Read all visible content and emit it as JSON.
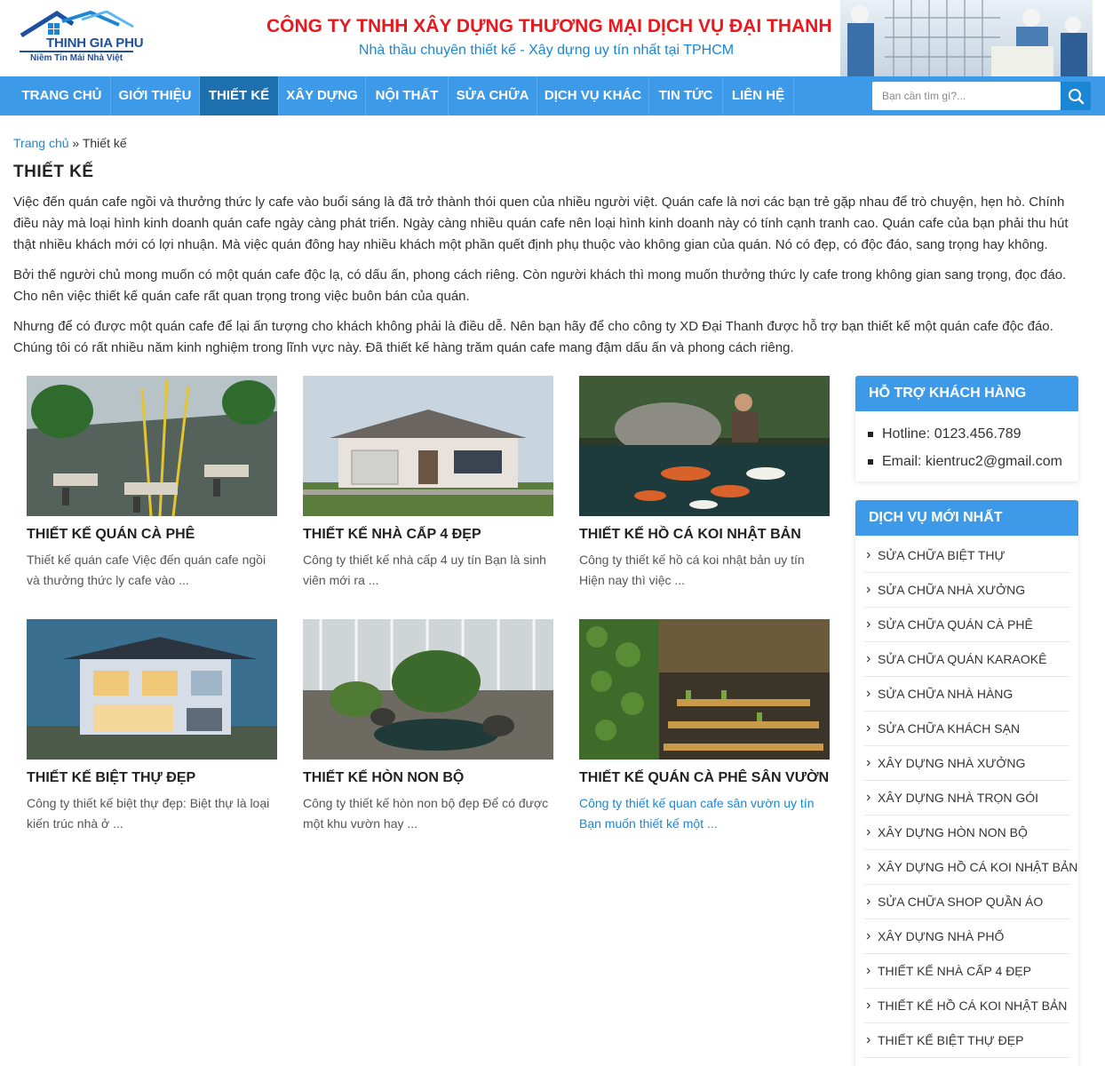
{
  "header": {
    "logo_name": "THINH GIA PHU",
    "logo_tagline": "Niềm Tin Mái Nhà Việt",
    "company_name": "CÔNG TY TNHH XÂY DỰNG THƯƠNG MẠI DỊCH VỤ ĐẠI THANH",
    "slogan": "Nhà thầu chuyên thiết kế - Xây dựng uy tín nhất tại TPHCM"
  },
  "nav": {
    "items": [
      "TRANG CHỦ",
      "GIỚI THIỆU",
      "THIẾT KẾ",
      "XÂY DỰNG",
      "NỘI THẤT",
      "SỬA CHỮA",
      "DỊCH VỤ KHÁC",
      "TIN TỨC",
      "LIÊN HỆ"
    ],
    "active": "THIẾT KẾ",
    "search_placeholder": "Bạn cần tìm gì?..."
  },
  "breadcrumb": {
    "home": "Trang chủ",
    "separator": "»",
    "current": "Thiết kế"
  },
  "page_title": "THIẾT KẾ",
  "intro": [
    "Việc đến quán cafe ngồi và thưởng thức ly cafe vào buổi sáng là đã trở thành thói quen của nhiều người việt. Quán cafe là nơi các bạn trẻ gặp nhau để trò chuyện, hẹn hò. Chính điều này mà loại hình kinh doanh quán cafe ngày càng phát triển. Ngày càng nhiều quán cafe nên loại hình kinh doanh này có tính cạnh tranh cao. Quán cafe của bạn phải thu hút thật nhiều khách mới có lợi nhuận. Mà việc quán đông hay nhiều khách một phần quết định phụ thuộc vào không gian của quán. Nó có đẹp, có độc đáo, sang trọng hay không.",
    "Bởi thế người chủ mong muốn có một quán cafe độc lạ, có dấu ấn, phong cách riêng.  Còn người khách thì mong muốn thưởng thức ly cafe trong không gian sang trọng, đọc đáo. Cho nên việc thiết kế quán cafe rất quan trọng trong việc buôn bán của quán.",
    "Nhưng để có được một quán cafe để lại ấn tượng cho khách không phải là điều dễ. Nên bạn hãy để cho công ty XD Đại Thanh được hỗ trợ bạn thiết kế một quán cafe độc đáo. Chúng tôi có rất nhiều năm kinh nghiệm trong lĩnh vực này. Đã thiết kế hàng trăm quán cafe mang đậm dấu ấn và phong cách riêng."
  ],
  "posts": [
    {
      "title": "THIẾT KẾ QUÁN CÀ PHÊ",
      "excerpt": "Thiết kế quán cafe Việc đến quán cafe ngồi và thưởng thức ly cafe vào ..."
    },
    {
      "title": "THIẾT KẾ NHÀ CẤP 4 ĐẸP",
      "excerpt": "Công ty thiết kế nhà cấp 4 uy tín Bạn là sinh viên mới ra ..."
    },
    {
      "title": "THIẾT KẾ HỒ CÁ KOI NHẬT BẢN",
      "excerpt": "Công ty thiết kế hồ cá koi nhật bản uy tín Hiện nay thì việc ..."
    },
    {
      "title": "THIẾT KẾ BIỆT THỰ ĐẸP",
      "excerpt": "Công ty thiết kế biệt thự đẹp: Biệt thự là loại kiến trúc nhà ở ..."
    },
    {
      "title": "THIẾT KẾ HÒN NON BỘ",
      "excerpt": "Công ty thiết kế hòn non bộ đẹp Để có được một khu vườn hay ..."
    },
    {
      "title": "THIẾT KẾ QUÁN CÀ PHÊ SÂN VƯỜN",
      "excerpt": "Công ty thiết kế quan cafe sân vườn uy tín Bạn muốn thiết kế một ..."
    }
  ],
  "sidebar": {
    "support": {
      "title": "HỖ TRỢ KHÁCH HÀNG",
      "hotline": "Hotline: 0123.456.789",
      "email": "Email: kientruc2@gmail.com"
    },
    "services": {
      "title": "DỊCH VỤ MỚI NHẤT",
      "items": [
        "SỬA CHỮA BIỆT THỰ",
        "SỬA CHỮA NHÀ XƯỞNG",
        "SỬA CHỮA QUÁN CÀ PHÊ",
        "SỬA CHỮA QUÁN KARAOKÊ",
        "SỬA CHỮA NHÀ HÀNG",
        "SỬA CHỮA KHÁCH SẠN",
        "XÂY DỰNG NHÀ XƯỞNG",
        "XÂY DỰNG NHÀ TRỌN GÓI",
        "XÂY DỰNG HÒN NON BỘ",
        "XÂY DỰNG HỒ CÁ KOI NHẬT BẢN",
        "SỬA CHỮA SHOP QUẦN ÁO",
        "XÂY DỰNG NHÀ PHỐ",
        "THIẾT KẾ NHÀ CẤP 4 ĐẸP",
        "THIẾT KẾ HỒ CÁ KOI NHẬT BẢN",
        "THIẾT KẾ BIỆT THỰ ĐẸP"
      ]
    }
  },
  "colors": {
    "nav_bg": "#3d9ae8",
    "nav_active": "#1e6fae",
    "company_red": "#e8181f",
    "link_blue": "#1b86d6"
  }
}
